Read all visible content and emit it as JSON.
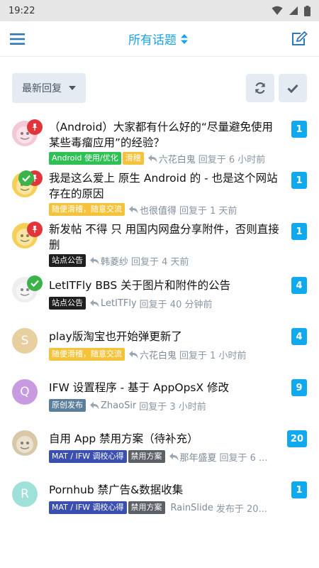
{
  "status_bar": {
    "time": "19:22",
    "icons": [
      "wifi-icon",
      "signal-icon",
      "battery-icon"
    ]
  },
  "app_bar": {
    "title": "所有话题",
    "menu_icon": "menu-icon",
    "compose_icon": "compose-icon"
  },
  "toolbar": {
    "sort_label": "最新回复",
    "refresh_icon": "refresh-icon",
    "mark_read_icon": "check-icon"
  },
  "colors": {
    "accent": "#1aa3e8",
    "count_badge": "#10a9ee",
    "pin": "#e0353b",
    "solved": "#3cb24a"
  },
  "topics": [
    {
      "title": "（Android）大家都有什么好的“尽量避免使用某些毒瘤应用”的经验？",
      "tags": [
        {
          "label": "Android 使用/优化",
          "color": "#2ebf55"
        },
        {
          "label": "滑稽",
          "color": "#f5c33b"
        }
      ],
      "user": "六花白鬼",
      "action": "回复于 6 小时前",
      "count": "1",
      "pinned": true,
      "solved": false,
      "avatar": {
        "type": "image",
        "color": "#f4c7d8"
      }
    },
    {
      "title": "我是这么爱上 原生 Android 的 - 也是这个网站存在的原因",
      "tags": [
        {
          "label": "随便滑稽，随意交流",
          "color": "#f5c33b"
        }
      ],
      "user": "也很值得",
      "action": "回复于 1 天前",
      "count": "1",
      "pinned": true,
      "solved": true,
      "avatar": {
        "type": "image",
        "color": "#f5cf56"
      }
    },
    {
      "title": "新发帖 不得 只 用国内网盘分享附件，否则直接删",
      "tags": [
        {
          "label": "站点公告",
          "color": "#1f1f1f"
        }
      ],
      "user": "韩菱纱",
      "action": "回复于 4 天前",
      "count": "1",
      "pinned": true,
      "solved": false,
      "avatar": {
        "type": "image",
        "color": "#f5cf56"
      }
    },
    {
      "title": "LetITFly BBS 关于图片和附件的公告",
      "tags": [
        {
          "label": "站点公告",
          "color": "#1f1f1f"
        }
      ],
      "user": "LetITFly",
      "action": "回复于 40 分钟前",
      "count": "4",
      "pinned": false,
      "solved": true,
      "avatar": {
        "type": "image",
        "color": "#eeeeee"
      }
    },
    {
      "title": "play版淘宝也开始弹更新了",
      "tags": [
        {
          "label": "随便滑稽，随意交流",
          "color": "#f5c33b"
        }
      ],
      "user": "六花白鬼",
      "action": "回复于 1 小时前",
      "count": "4",
      "pinned": false,
      "solved": false,
      "avatar": {
        "type": "letter",
        "letter": "S",
        "color": "#e8cfa0"
      }
    },
    {
      "title": "IFW 设置程序 - 基于 AppOpsX 修改",
      "tags": [
        {
          "label": "原创发布",
          "color": "#5b7f9a"
        }
      ],
      "user": "ZhaoSir",
      "action": "回复于 3 小时前",
      "count": "9",
      "pinned": false,
      "solved": false,
      "avatar": {
        "type": "letter",
        "letter": "Q",
        "color": "#c89ae0"
      }
    },
    {
      "title": "自用 App 禁用方案（待补充）",
      "tags": [
        {
          "label": "MAT / IFW 调校心得",
          "color": "#3b4fb0"
        },
        {
          "label": "禁用方案",
          "color": "#5b5f66"
        }
      ],
      "user": "那年盛夏",
      "action": "回复于 6 ...",
      "count": "20",
      "pinned": false,
      "solved": false,
      "avatar": {
        "type": "image",
        "color": "#d9c8a8"
      }
    },
    {
      "title": "Pornhub 禁广告&数据收集",
      "tags": [
        {
          "label": "MAT / IFW 调校心得",
          "color": "#3b4fb0"
        },
        {
          "label": "禁用方案",
          "color": "#5b5f66"
        }
      ],
      "user": "RainSlide",
      "action": "发布于 20...",
      "count": "1",
      "pinned": false,
      "solved": false,
      "avatar": {
        "type": "letter",
        "letter": "R",
        "color": "#9fe0d8"
      }
    }
  ]
}
